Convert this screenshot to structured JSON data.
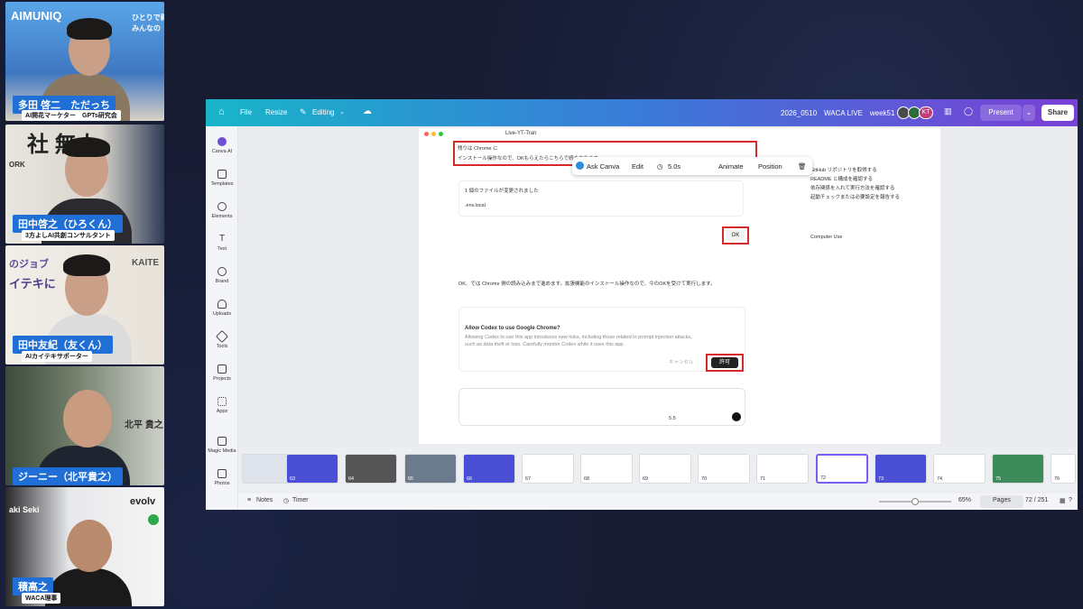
{
  "participants": [
    {
      "name": "多田 啓二　ただっち",
      "role": "AI開花マーケター　GPTs研究会",
      "bg_text_1": "AIMUNIQ",
      "bg_text_2": "ひとりで稼",
      "bg_text_3": "みんなの"
    },
    {
      "name": "田中啓之（ひろくん）",
      "role": "3方よしAI共創コンサルタント",
      "bg_text_1": "社 無人",
      "bg_text_2": "ORK"
    },
    {
      "name": "田中友紀（友くん）",
      "role": "AIカイテキサポーター",
      "bg_text_1": "KAITE",
      "bg_text_2": "のジョブ",
      "bg_text_3": "イテキに"
    },
    {
      "name": "ジーニー（北平貴之）",
      "role": "",
      "bg_text_1": "北平 貴之"
    },
    {
      "name": "積高之",
      "role": "WACA理事",
      "bg_text_1": "evolv",
      "bg_text_2": "aki Seki"
    }
  ],
  "canva": {
    "topbar": {
      "file": "File",
      "resize": "Resize",
      "editing": "Editing",
      "doc_title": "2026_0510　WACA LIVE　week51",
      "avatar_initials": "KT",
      "present": "Present",
      "share": "Share"
    },
    "sidebar": [
      "Canva AI",
      "Templates",
      "Elements",
      "Text",
      "Brand",
      "Uploads",
      "Tools",
      "Projects",
      "Apps",
      "Magic Media",
      "Photos"
    ],
    "float_toolbar": {
      "ask": "Ask Canva",
      "edit": "Edit",
      "duration": "5.0s",
      "animate": "Animate",
      "position": "Position"
    },
    "slide": {
      "tab_title": "Live-YT-Tran",
      "top_line_1": "残りは Chrome に",
      "top_line_2": "インストール操作なので、OKもらえたらこちらで続きやります。",
      "files_changed": "1 個のファイルが変更されました",
      "env_file": ".env.local",
      "ok_label": "OK",
      "main_text": "OK、では Chrome 側の読み込みまで進めます。拡張機能のインストール操作なので、今のOKを受けて実行します。",
      "allow_title": "Allow Codex to use Google Chrome?",
      "allow_body_1": "Allowing Codex to use this app introduces new risks, including those related to prompt injection attacks,",
      "allow_body_2": "such as data theft or loss. Carefully monitor Codex while it uses this app.",
      "cancel": "キャンセル",
      "allow": "許可",
      "model": "5.5",
      "checklist": [
        "GitHub リポジトリを取得する",
        "README と構成を確認する",
        "依存関係を入れて実行方法を確認する",
        "起動チェックまたは必要設定を報告する"
      ],
      "computer_use": "Computer Use"
    },
    "filmstrip": [
      "63",
      "64",
      "65",
      "66",
      "67",
      "68",
      "69",
      "70",
      "71",
      "72",
      "73",
      "74",
      "75",
      "76"
    ],
    "bottombar": {
      "notes": "Notes",
      "timer": "Timer",
      "zoom": "65%",
      "pages": "Pages",
      "page_count": "72 / 251"
    }
  }
}
